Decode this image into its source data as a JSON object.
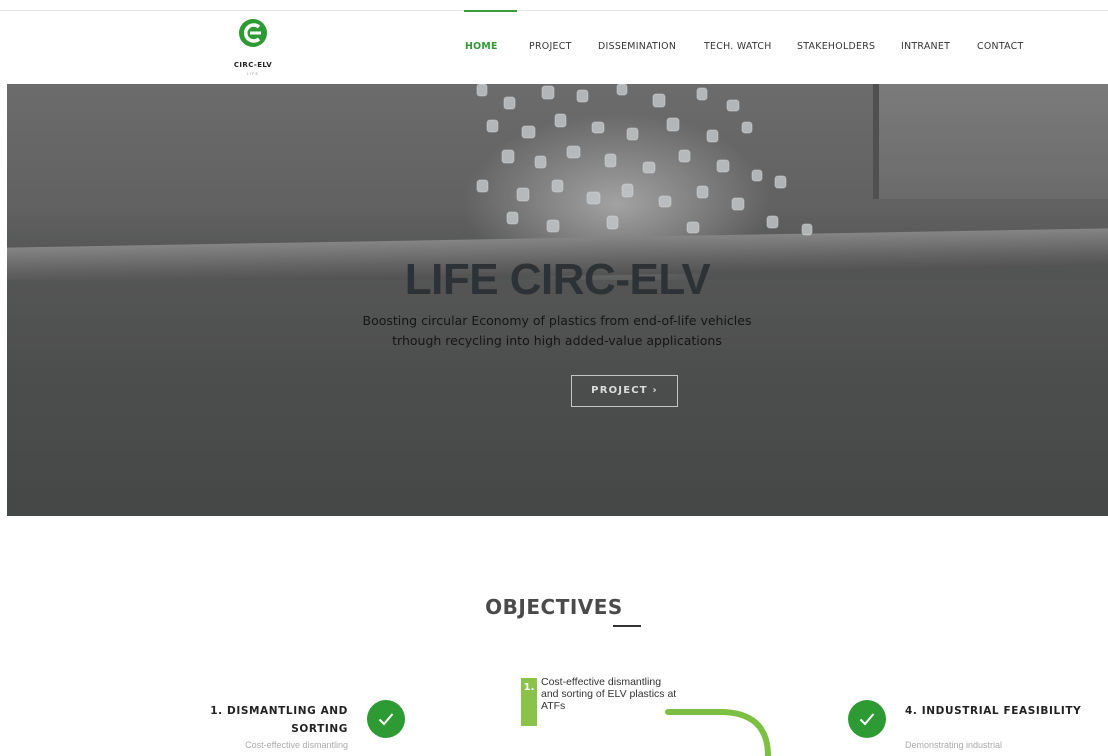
{
  "logo": {
    "name": "CIRC-ELV",
    "sub": "LIFE"
  },
  "nav": {
    "items": [
      {
        "label": "HOME",
        "active": true
      },
      {
        "label": "PROJECT"
      },
      {
        "label": "DISSEMINATION"
      },
      {
        "label": "TECH. WATCH"
      },
      {
        "label": "STAKEHOLDERS"
      },
      {
        "label": "INTRANET"
      },
      {
        "label": "CONTACT"
      }
    ]
  },
  "hero": {
    "title": "LIFE CIRC-ELV",
    "subtitle": "Boosting circular Economy of plastics from end-of-life vehicles trhough recycling into high added-value applications",
    "button_label": "PROJECT  ›"
  },
  "objectives": {
    "title": "OBJECTIVES",
    "left": {
      "title": "1. DISMANTLING AND SORTING",
      "desc": "Cost-effective dismantling"
    },
    "right": {
      "title": "4. INDUSTRIAL FEASIBILITY",
      "desc": "Demonstrating industrial"
    },
    "diagram": {
      "number": "1.",
      "text": "Cost-effective dismantling and sorting of ELV plastics at ATFs"
    }
  },
  "colors": {
    "brand_green": "#2e9a33",
    "accent_lime": "#8bc34a"
  }
}
